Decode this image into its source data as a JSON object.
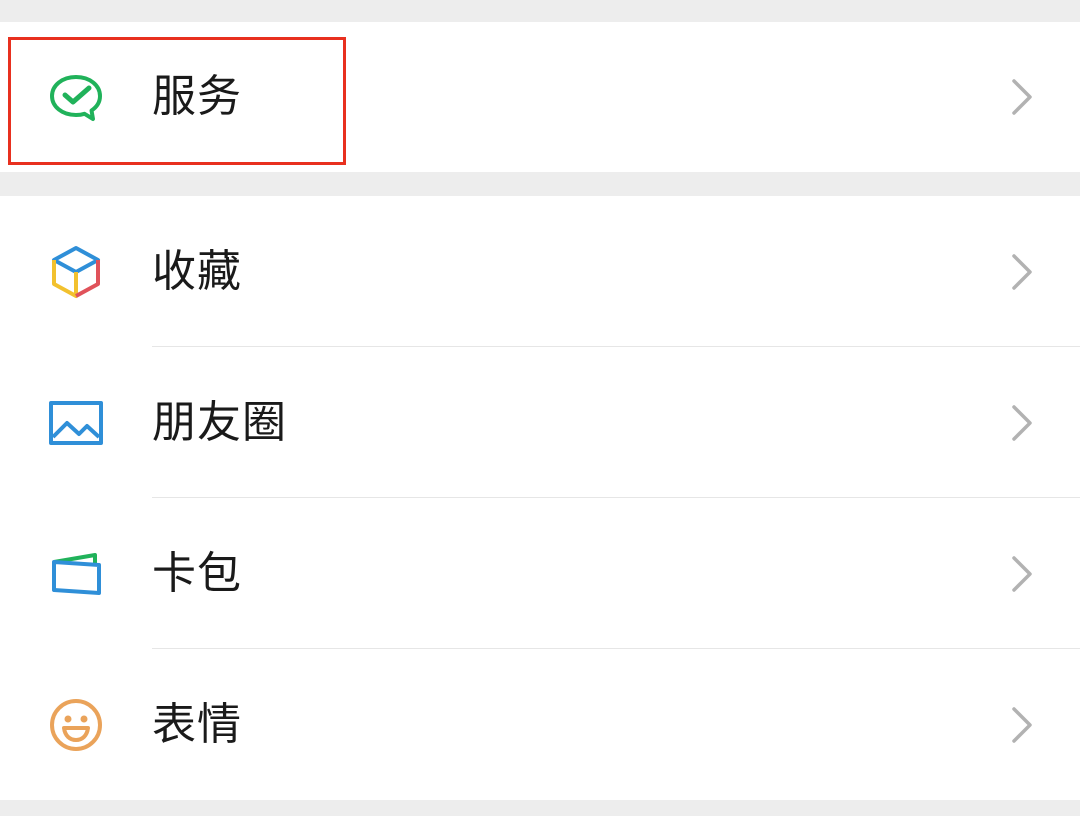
{
  "colors": {
    "page_background": "#ededed",
    "cell_background": "#ffffff",
    "label_text": "#1a1a1a",
    "chevron": "#b2b2b2",
    "highlight_box": "#e8301f",
    "service_icon": "#20b25a"
  },
  "group_1": {
    "items": [
      {
        "label": "服务",
        "icon": "wechat-pay-check-icon",
        "highlighted": true
      }
    ]
  },
  "group_2": {
    "items": [
      {
        "label": "收藏",
        "icon": "favorites-cube-icon"
      },
      {
        "label": "朋友圈",
        "icon": "moments-picture-icon"
      },
      {
        "label": "卡包",
        "icon": "card-wallet-icon"
      },
      {
        "label": "表情",
        "icon": "smiley-face-icon"
      }
    ]
  }
}
